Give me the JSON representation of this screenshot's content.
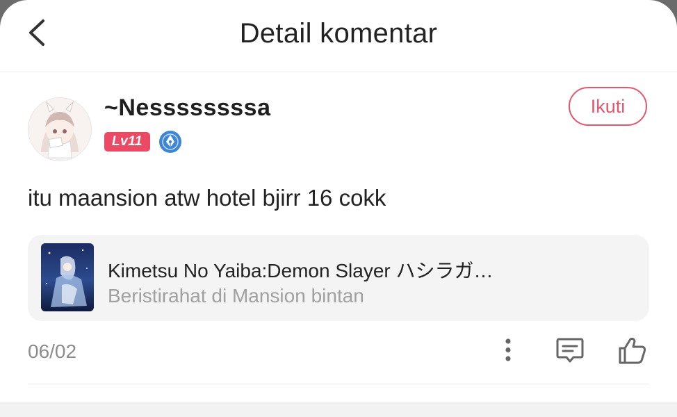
{
  "header": {
    "title": "Detail komentar",
    "back_icon": "chevron-left-icon"
  },
  "user": {
    "name": "~Nessssssssa",
    "level": "Lv11",
    "follow_label": "Ikuti",
    "verify_icon": "verified-pen-icon"
  },
  "comment": {
    "text": "itu maansion atw hotel bjirr 16 cokk"
  },
  "card": {
    "title": "Kimetsu No Yaiba:Demon Slayer ハシラガ…",
    "subtitle": "Beristirahat di Mansion bintan"
  },
  "footer": {
    "date": "06/02",
    "icons": [
      "more-vertical-icon",
      "comment-icon",
      "like-icon"
    ]
  },
  "colors": {
    "accent": "#e45670",
    "level_badge": "#ea4a63",
    "verify_blue": "#3d86d6"
  }
}
